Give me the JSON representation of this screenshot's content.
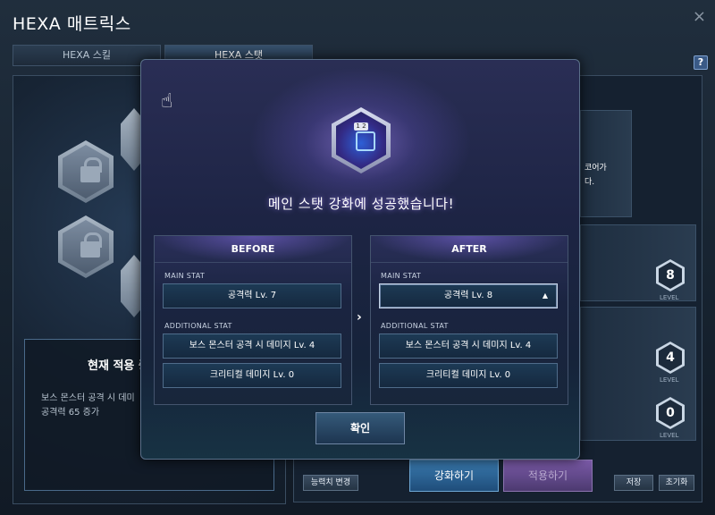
{
  "window": {
    "title": "HEXA 매트릭스",
    "close_icon": "×",
    "help_label": "?"
  },
  "tabs": [
    {
      "label": "HEXA 스킬"
    },
    {
      "label": "HEXA 스탯"
    }
  ],
  "left_panel": {
    "current_title": "현재 적용 중",
    "current_lines": [
      "보스 몬스터 공격 시 데미",
      "공격력 65 증가"
    ]
  },
  "right_panel": {
    "snippet_1": "코어가",
    "snippet_2": "다.",
    "levels": [
      {
        "value": "8",
        "label": "LEVEL"
      },
      {
        "value": "4",
        "label": "LEVEL"
      },
      {
        "value": "0",
        "label": "LEVEL"
      }
    ],
    "buttons": {
      "change_stat": "능력치 변경",
      "enhance": "강화하기",
      "apply": "적용하기",
      "save": "저장",
      "reset": "초기화"
    }
  },
  "modal": {
    "gem_badge": "1 2",
    "success_message": "메인 스탯 강화에 성공했습니다!",
    "before": {
      "header": "BEFORE",
      "main_stat_label": "MAIN STAT",
      "main_stat": "공격력 Lv. 7",
      "additional_stat_label": "ADDITIONAL STAT",
      "additional": [
        "보스 몬스터 공격 시 데미지 Lv. 4",
        "크리티컬 데미지 Lv. 0"
      ]
    },
    "after": {
      "header": "AFTER",
      "main_stat_label": "MAIN STAT",
      "main_stat": "공격력 Lv. 8",
      "additional_stat_label": "ADDITIONAL STAT",
      "additional": [
        "보스 몬스터 공격 시 데미지 Lv. 4",
        "크리티컬 데미지 Lv. 0"
      ]
    },
    "arrow_glyph": "›",
    "up_glyph": "▲",
    "confirm_label": "확인"
  },
  "icons": {
    "pointer": "pointer-hand-icon",
    "lock": "lock-icon",
    "close": "close-icon",
    "help": "help-icon"
  }
}
